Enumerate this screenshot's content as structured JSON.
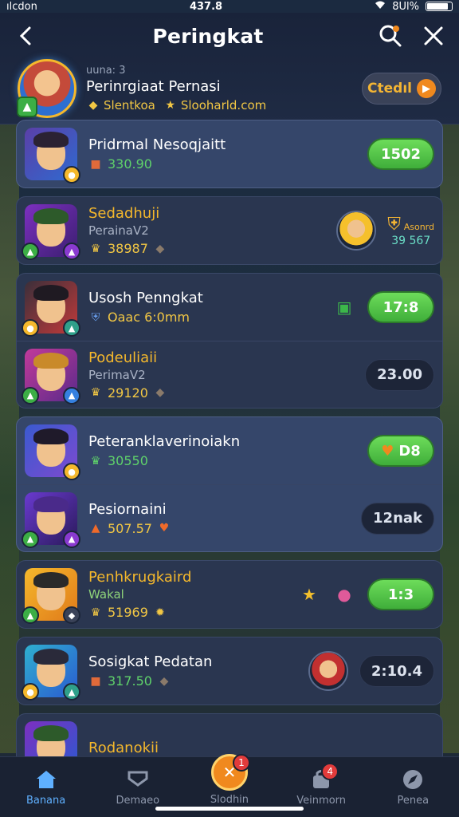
{
  "status": {
    "left": "ılcdon",
    "time": "437.8",
    "battery": "8Ul%"
  },
  "header": {
    "title": "Peringkat"
  },
  "profile": {
    "sub": "uuna: 3",
    "name": "Perinrgiaat Pernasi",
    "meta1": "Slentkoa",
    "meta2": "Slooharld.com",
    "cta_label": "Ctedıl"
  },
  "rows": [
    {
      "name": "Pridrmal Nesoqjaitt",
      "score": "330.90",
      "value": "1502"
    },
    {
      "name": "Sedadhuji",
      "sub": "PerainaV2",
      "score": "38987",
      "award_title": "Asonrd",
      "award_value": "39 567"
    },
    {
      "name": "Usosh Penngkat",
      "score": "Oaac 6:0mm",
      "value": "17:8"
    },
    {
      "name": "Podeuliaii",
      "sub": "PerimaV2",
      "score": "29120",
      "value": "23.00"
    },
    {
      "name": "Peteranklaverinoiakn",
      "score": "30550",
      "value": "D8"
    },
    {
      "name": "Pesiornaini",
      "score": "507.57",
      "value": "12nak"
    },
    {
      "name": "Penhkrugkaird",
      "sub": "Wakal",
      "score": "51969",
      "value": "1:3"
    },
    {
      "name": "Sosigkat Pedatan",
      "score": "317.50",
      "value": "2:10.4"
    },
    {
      "name": "Rodanokii"
    }
  ],
  "tabs": [
    {
      "label": "Banana"
    },
    {
      "label": "Demaeo"
    },
    {
      "label": "Slodhin",
      "badge": "1"
    },
    {
      "label": "Veinmorn",
      "badge": "4"
    },
    {
      "label": "Penea"
    }
  ],
  "colors": {
    "accent": "#f0891e",
    "green": "#4fc144",
    "gold": "#f5b82c",
    "bg": "#1d2a3f"
  }
}
